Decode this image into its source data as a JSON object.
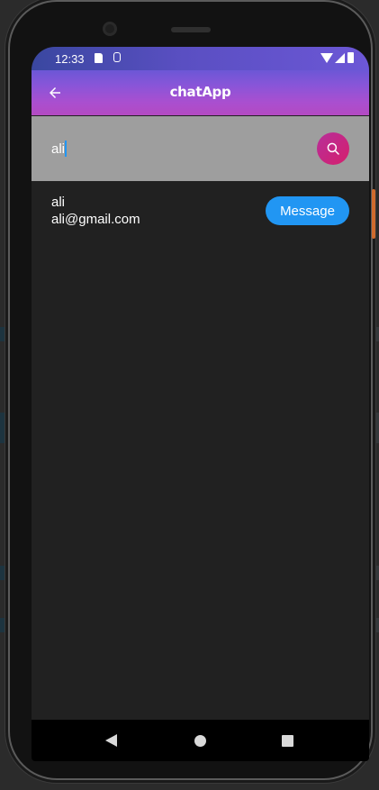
{
  "status_bar": {
    "time": "12:33"
  },
  "app_bar": {
    "title": "chatApp",
    "back_icon": "arrow-back-icon"
  },
  "search": {
    "value": "ali",
    "button_icon": "search-icon"
  },
  "results": [
    {
      "name": "ali",
      "email": "ali@gmail.com",
      "action_label": "Message"
    }
  ],
  "nav_bar": {
    "icons": [
      "nav-back-icon",
      "nav-home-icon",
      "nav-recents-icon"
    ]
  },
  "colors": {
    "accent": "#2196f3",
    "search_button": "#c7277f",
    "app_bar_gradient_start": "#6c57d6",
    "app_bar_gradient_end": "#b44ac2",
    "background": "#212121",
    "search_bar_bg": "#9e9e9e"
  }
}
